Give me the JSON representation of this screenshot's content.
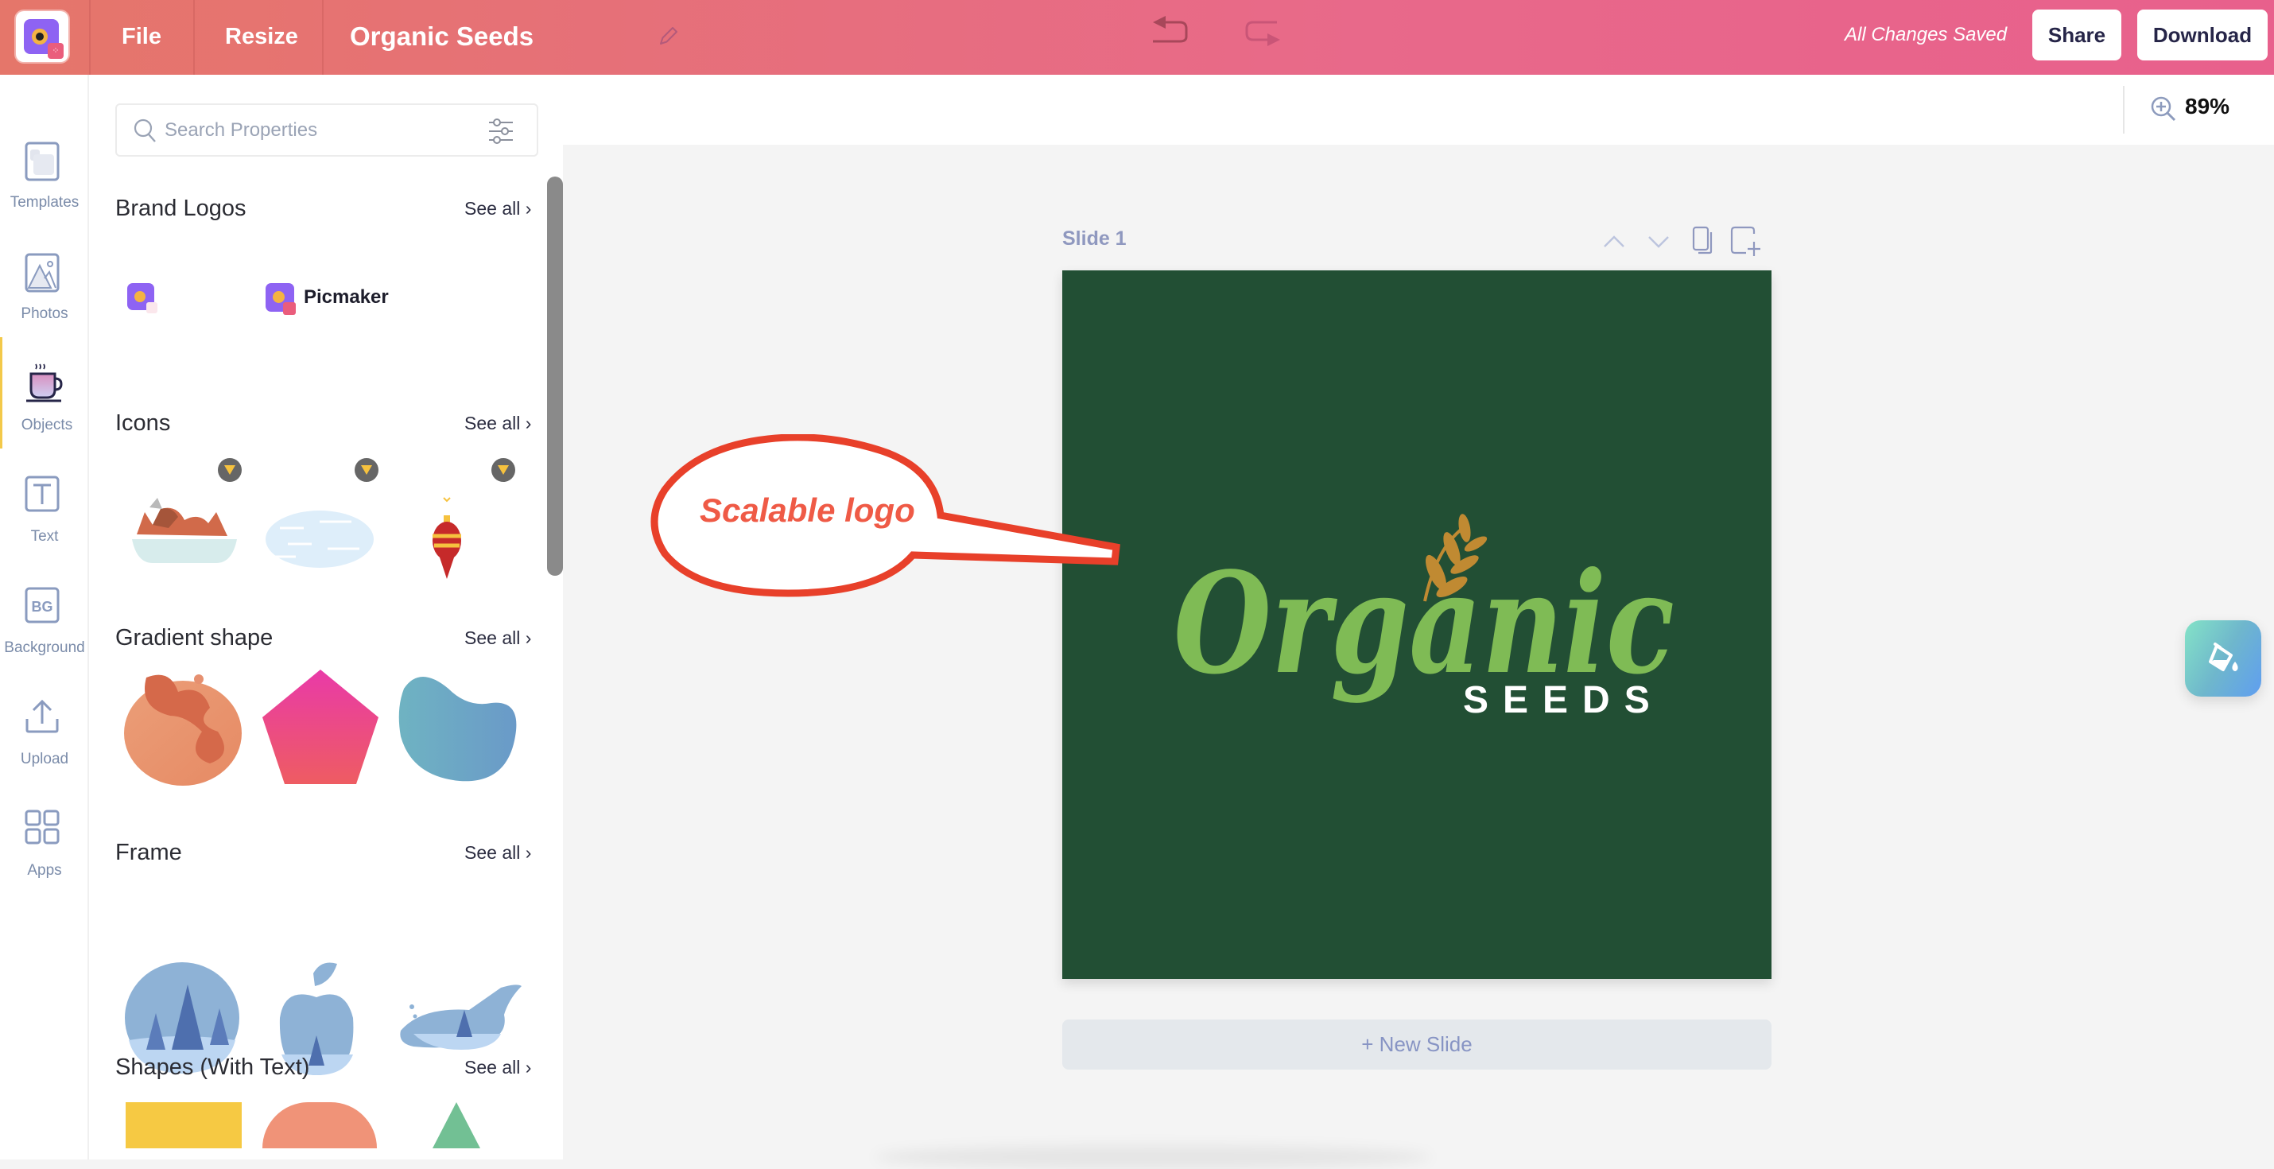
{
  "header": {
    "menu": {
      "file": "File",
      "resize": "Resize"
    },
    "doc_title": "Organic Seeds",
    "save_status": "All Changes Saved",
    "share_label": "Share",
    "download_label": "Download",
    "gradient_start": "#e5766a",
    "gradient_end": "#e8608c"
  },
  "toolbar": {
    "zoom_level": "89%"
  },
  "rail": {
    "items": [
      {
        "label": "Templates",
        "icon": "templates-icon"
      },
      {
        "label": "Photos",
        "icon": "photos-icon"
      },
      {
        "label": "Objects",
        "icon": "objects-cup-icon",
        "active": true
      },
      {
        "label": "Text",
        "icon": "text-icon"
      },
      {
        "label": "Background",
        "icon": "background-icon",
        "glyph": "BG"
      },
      {
        "label": "Upload",
        "icon": "upload-icon"
      },
      {
        "label": "Apps",
        "icon": "apps-grid-icon"
      }
    ]
  },
  "panel": {
    "search_placeholder": "Search Properties",
    "see_all": "See all",
    "sections": [
      {
        "title": "Brand Logos",
        "items": [
          "picmaker-logo-icon",
          "picmaker-logo-wordmark"
        ],
        "wordmark": "Picmaker"
      },
      {
        "title": "Icons",
        "items": [
          "roast-dish",
          "clouds",
          "ornament"
        ],
        "premium": true
      },
      {
        "title": "Gradient shape",
        "items": [
          "orange-blob",
          "pink-pentagon",
          "blue-blob"
        ]
      },
      {
        "title": "Frame",
        "items": [
          "circle-forest-frame",
          "apple-forest-frame",
          "whale-forest-frame"
        ]
      },
      {
        "title": "Shapes (With Text)",
        "items": [
          "yellow-rectangle",
          "salmon-semicircle",
          "green-triangle"
        ]
      }
    ]
  },
  "canvas": {
    "slide_label": "Slide 1",
    "slide_bg": "#224f34",
    "logo_script": "Organic",
    "logo_sub": "SEEDS",
    "logo_green": "#7fbb55",
    "logo_wheat": "#c08a32",
    "new_slide_label": "+ New Slide"
  },
  "callout": {
    "text": "Scalable logo",
    "color": "#e8402a"
  }
}
